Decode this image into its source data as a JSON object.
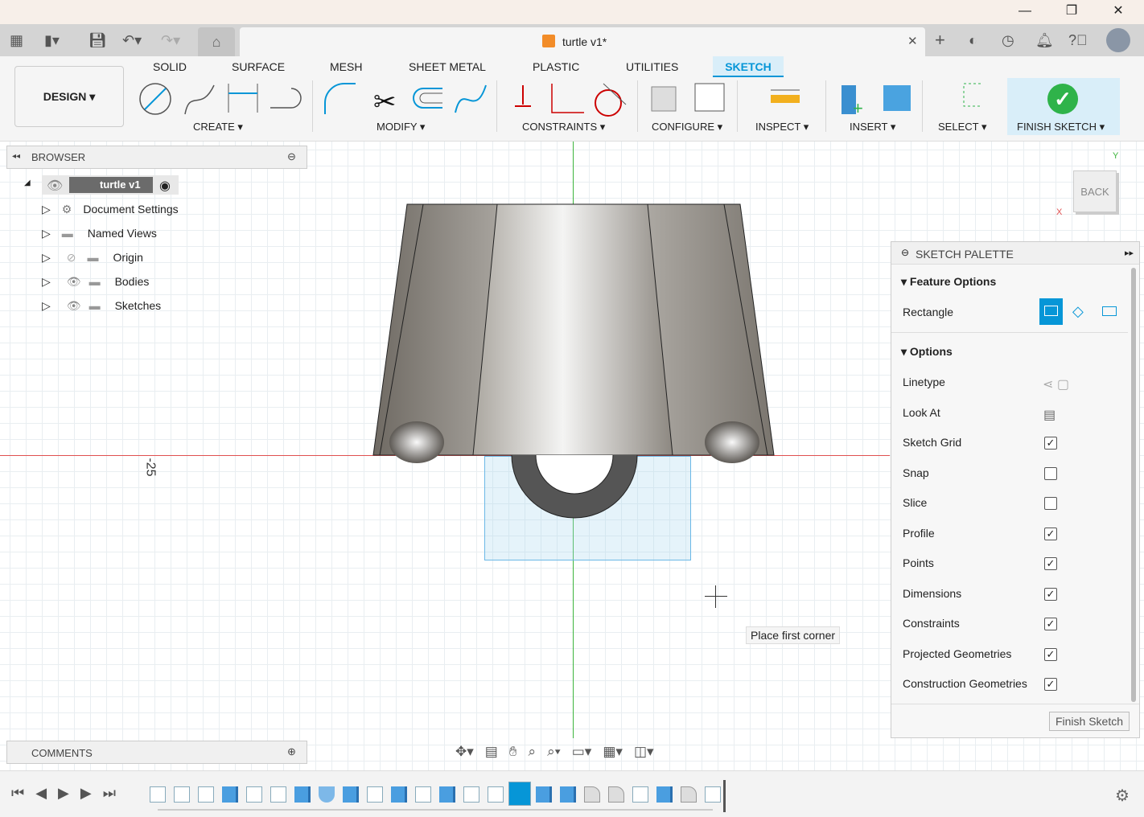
{
  "window": {
    "minimize": "—",
    "restore": "❐",
    "close": "✕"
  },
  "document": {
    "title": "turtle v1*",
    "close": "✕"
  },
  "workspace": {
    "label": "DESIGN ▾"
  },
  "ribbon": {
    "tabs": [
      "SOLID",
      "SURFACE",
      "MESH",
      "SHEET METAL",
      "PLASTIC",
      "UTILITIES",
      "SKETCH"
    ],
    "active_tab": "SKETCH",
    "groups": [
      "CREATE ▾",
      "MODIFY ▾",
      "CONSTRAINTS ▾",
      "CONFIGURE ▾",
      "INSPECT ▾",
      "INSERT ▾",
      "SELECT ▾",
      "FINISH SKETCH ▾"
    ]
  },
  "browser": {
    "title": "BROWSER",
    "root": "turtle v1",
    "items": [
      "Document Settings",
      "Named Views",
      "Origin",
      "Bodies",
      "Sketches"
    ]
  },
  "comments": {
    "title": "COMMENTS"
  },
  "viewcube": {
    "face": "BACK",
    "x_axis": "X",
    "y_axis": "Y"
  },
  "canvas": {
    "dimension_label": "-25",
    "tooltip": "Place first corner"
  },
  "palette": {
    "title": "SKETCH PALETTE",
    "feature_options": "Feature Options",
    "rectangle_label": "Rectangle",
    "options": "Options",
    "rows": [
      {
        "label": "Linetype",
        "type": "icons"
      },
      {
        "label": "Look At",
        "type": "icon"
      },
      {
        "label": "Sketch Grid",
        "checked": true
      },
      {
        "label": "Snap",
        "checked": false
      },
      {
        "label": "Slice",
        "checked": false
      },
      {
        "label": "Profile",
        "checked": true
      },
      {
        "label": "Points",
        "checked": true
      },
      {
        "label": "Dimensions",
        "checked": true
      },
      {
        "label": "Constraints",
        "checked": true
      },
      {
        "label": "Projected Geometries",
        "checked": true
      },
      {
        "label": "Construction Geometries",
        "checked": true
      }
    ],
    "finish_button": "Finish Sketch"
  },
  "timeline": {
    "items": [
      "sketch",
      "sketch",
      "sketch",
      "extrude",
      "sketch",
      "sketch",
      "extrude",
      "loft",
      "extrude",
      "sketch",
      "extrude",
      "sketch",
      "extrude",
      "sketch",
      "sketch",
      "sketch-active",
      "extrude",
      "extrude",
      "fillet",
      "fillet",
      "sketch",
      "extrude",
      "fillet",
      "sketch"
    ]
  },
  "colors": {
    "accent": "#0696d7",
    "sketch_tab": "#d9eef9",
    "finish": "#2fb34a",
    "axis_red": "#e05050",
    "axis_green": "#3cb43c"
  }
}
